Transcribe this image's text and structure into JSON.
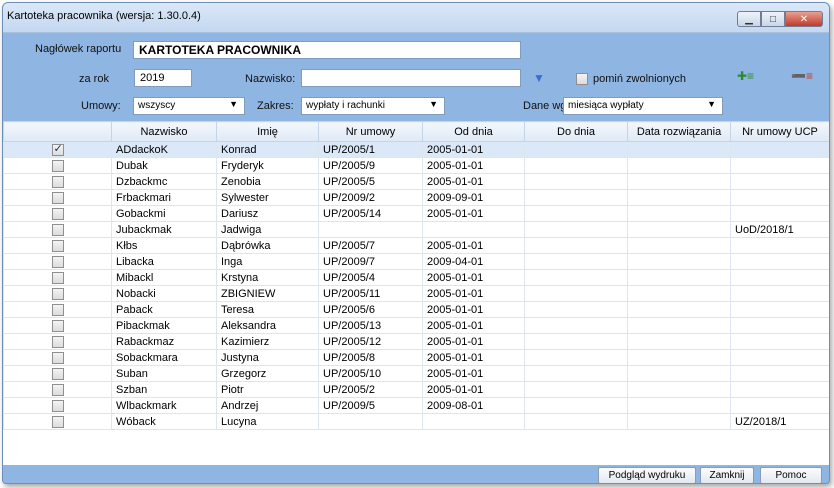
{
  "window": {
    "title": "Kartoteka pracownika  (wersja: 1.30.0.4)"
  },
  "form": {
    "report_header_label": "Nagłówek raportu",
    "report_header_value": "KARTOTEKA PRACOWNIKA",
    "year_label": "za rok",
    "year_value": "2019",
    "surname_label": "Nazwisko:",
    "surname_value": "",
    "skip_dismissed_label": "pomiń zwolnionych",
    "contracts_label": "Umowy:",
    "contracts_value": "wszyscy",
    "scope_label": "Zakres:",
    "scope_value": "wypłaty i rachunki",
    "data_by_label": "Dane wg:",
    "data_by_value": "miesiąca wypłaty"
  },
  "table": {
    "columns": [
      "",
      "Nazwisko",
      "Imię",
      "Nr umowy",
      "Od dnia",
      "Do dnia",
      "Data rozwiązania",
      "Nr umowy UCP"
    ],
    "rows": [
      {
        "checked": true,
        "surname": "ADdackoK",
        "name": "Konrad",
        "contract": "UP/2005/1",
        "from": "2005-01-01",
        "to": "",
        "end": "",
        "ucp": ""
      },
      {
        "checked": false,
        "surname": "Dubak",
        "name": "Fryderyk",
        "contract": "UP/2005/9",
        "from": "2005-01-01",
        "to": "",
        "end": "",
        "ucp": ""
      },
      {
        "checked": false,
        "surname": "Dzbackmc",
        "name": "Zenobia",
        "contract": "UP/2005/5",
        "from": "2005-01-01",
        "to": "",
        "end": "",
        "ucp": ""
      },
      {
        "checked": false,
        "surname": "Frbackmari",
        "name": "Sylwester",
        "contract": "UP/2009/2",
        "from": "2009-09-01",
        "to": "",
        "end": "",
        "ucp": ""
      },
      {
        "checked": false,
        "surname": "Gobackmi",
        "name": "Dariusz",
        "contract": "UP/2005/14",
        "from": "2005-01-01",
        "to": "",
        "end": "",
        "ucp": ""
      },
      {
        "checked": false,
        "surname": "Jubackmak",
        "name": "Jadwiga",
        "contract": "",
        "from": "",
        "to": "",
        "end": "",
        "ucp": "UoD/2018/1"
      },
      {
        "checked": false,
        "surname": "Kłbs",
        "name": "Dąbrówka",
        "contract": "UP/2005/7",
        "from": "2005-01-01",
        "to": "",
        "end": "",
        "ucp": ""
      },
      {
        "checked": false,
        "surname": "Libacka",
        "name": "Inga",
        "contract": "UP/2009/7",
        "from": "2009-04-01",
        "to": "",
        "end": "",
        "ucp": ""
      },
      {
        "checked": false,
        "surname": "Mibackl",
        "name": "Krstyna",
        "contract": "UP/2005/4",
        "from": "2005-01-01",
        "to": "",
        "end": "",
        "ucp": ""
      },
      {
        "checked": false,
        "surname": "Nobacki",
        "name": "ZBIGNIEW",
        "contract": "UP/2005/11",
        "from": "2005-01-01",
        "to": "",
        "end": "",
        "ucp": ""
      },
      {
        "checked": false,
        "surname": "Paback",
        "name": "Teresa",
        "contract": "UP/2005/6",
        "from": "2005-01-01",
        "to": "",
        "end": "",
        "ucp": ""
      },
      {
        "checked": false,
        "surname": "Pibackmak",
        "name": "Aleksandra",
        "contract": "UP/2005/13",
        "from": "2005-01-01",
        "to": "",
        "end": "",
        "ucp": ""
      },
      {
        "checked": false,
        "surname": "Rabackmaz",
        "name": "Kazimierz",
        "contract": "UP/2005/12",
        "from": "2005-01-01",
        "to": "",
        "end": "",
        "ucp": ""
      },
      {
        "checked": false,
        "surname": "Sobackmara",
        "name": "Justyna",
        "contract": "UP/2005/8",
        "from": "2005-01-01",
        "to": "",
        "end": "",
        "ucp": ""
      },
      {
        "checked": false,
        "surname": "Suban",
        "name": "Grzegorz",
        "contract": "UP/2005/10",
        "from": "2005-01-01",
        "to": "",
        "end": "",
        "ucp": ""
      },
      {
        "checked": false,
        "surname": "Szban",
        "name": "Piotr",
        "contract": "UP/2005/2",
        "from": "2005-01-01",
        "to": "",
        "end": "",
        "ucp": ""
      },
      {
        "checked": false,
        "surname": "Wlbackmark",
        "name": "Andrzej",
        "contract": "UP/2009/5",
        "from": "2009-08-01",
        "to": "",
        "end": "",
        "ucp": ""
      },
      {
        "checked": false,
        "surname": "Wóback",
        "name": "Lucyna",
        "contract": "",
        "from": "",
        "to": "",
        "end": "",
        "ucp": "UZ/2018/1"
      }
    ]
  },
  "footer": {
    "preview_label": "Podgląd wydruku",
    "close_label": "Zamknij",
    "help_label": "Pomoc"
  },
  "icons": {
    "filter": "filter-icon",
    "export_add": "list-add-icon",
    "export_remove": "list-remove-icon"
  },
  "colors": {
    "window_bg": "#8fb5e3",
    "selected_row": "#dbe8f7",
    "close_btn": "#c0392b"
  }
}
